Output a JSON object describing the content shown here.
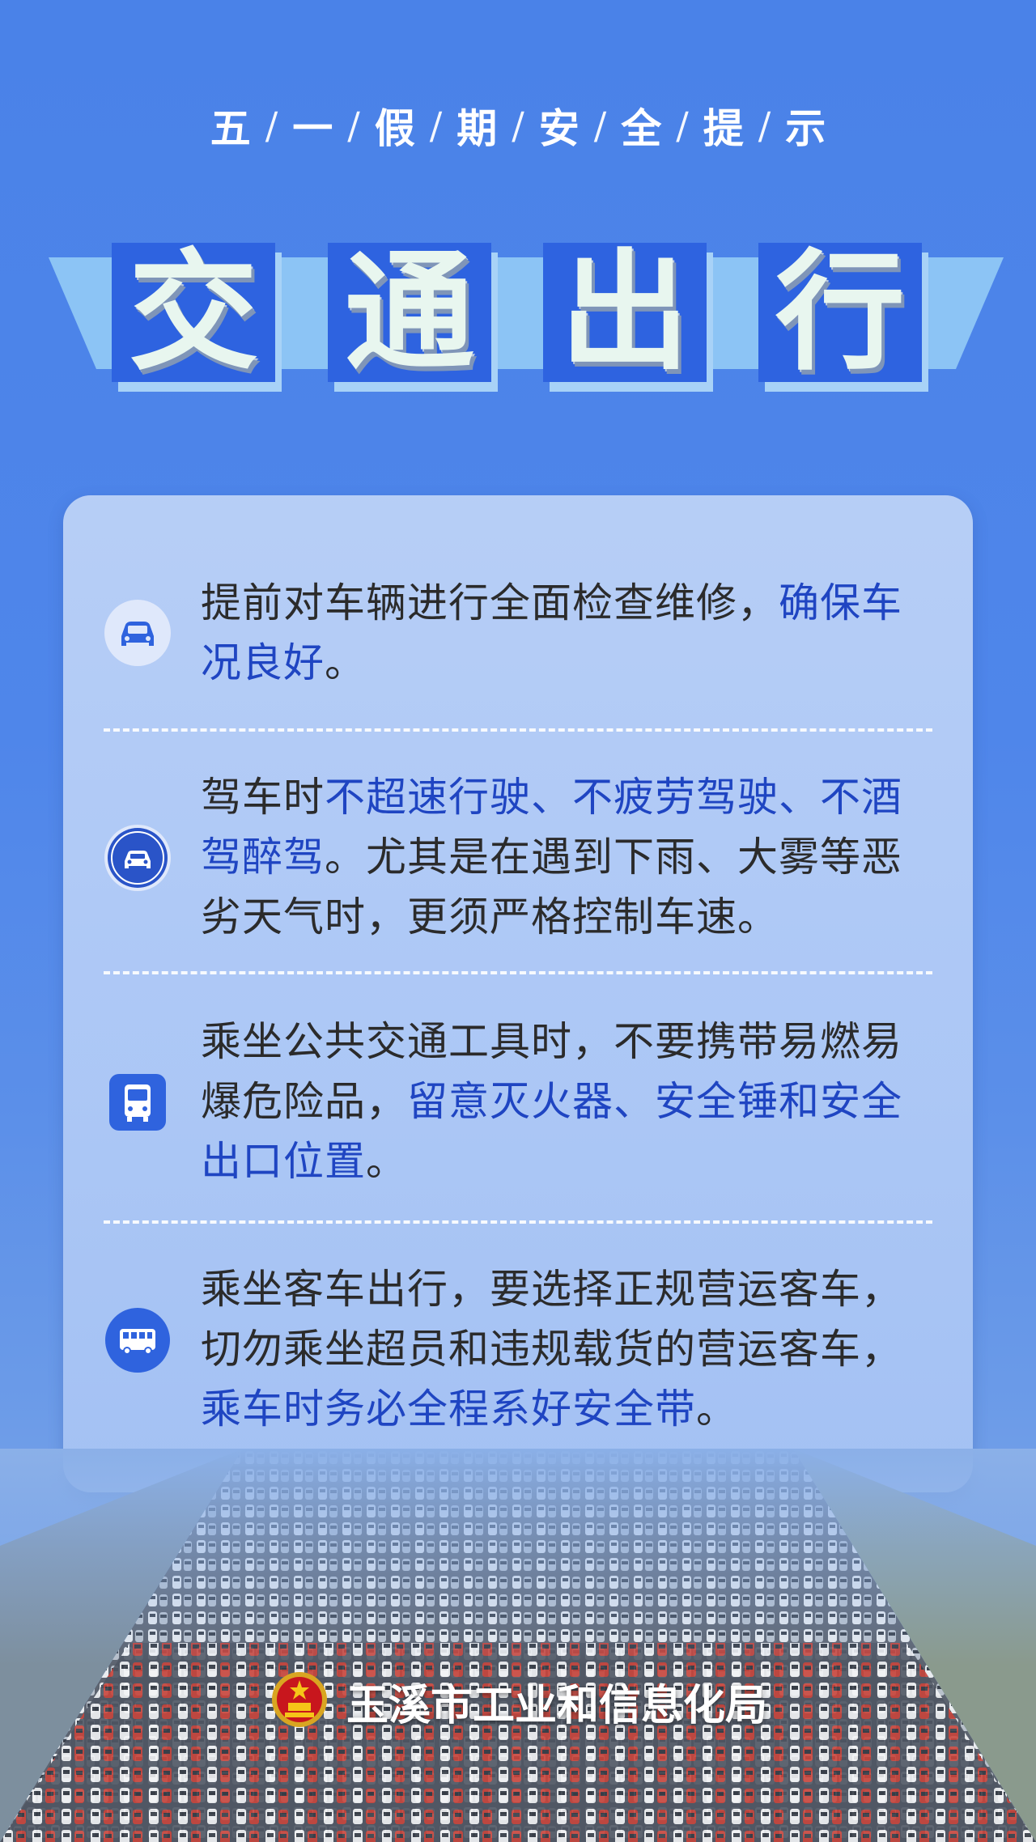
{
  "header": {
    "subtitle_chars": [
      "五",
      "一",
      "假",
      "期",
      "安",
      "全",
      "提",
      "示"
    ],
    "separator": "/",
    "title_chars": [
      "交",
      "通",
      "出",
      "行"
    ]
  },
  "tips": [
    {
      "icon": "car-front-icon",
      "segments": [
        {
          "text": "提前对车辆进行全面检查维修，",
          "highlight": false
        },
        {
          "text": "确保车况良好",
          "highlight": true
        },
        {
          "text": "。",
          "highlight": false
        }
      ]
    },
    {
      "icon": "car-badge-icon",
      "segments": [
        {
          "text": "驾车时",
          "highlight": false
        },
        {
          "text": "不超速行驶、不疲劳驾驶、不酒驾醉驾",
          "highlight": true
        },
        {
          "text": "。尤其是在遇到下雨、大雾等恶劣天气时，更须严格控制车速。",
          "highlight": false
        }
      ]
    },
    {
      "icon": "bus-icon",
      "segments": [
        {
          "text": "乘坐公共交通工具时，不要携带易燃易爆危险品，",
          "highlight": false
        },
        {
          "text": "留意灭火器、安全锤和安全出口位置",
          "highlight": true
        },
        {
          "text": "。",
          "highlight": false
        }
      ]
    },
    {
      "icon": "coach-icon",
      "segments": [
        {
          "text": "乘坐客车出行，要选择正规营运客车，切勿乘坐超员和违规载货的营运客车，",
          "highlight": false
        },
        {
          "text": "乘车时务必全程系好安全带",
          "highlight": true
        },
        {
          "text": "。",
          "highlight": false
        }
      ]
    }
  ],
  "footer": {
    "emblem": "national-emblem-icon",
    "organization": "玉溪市工业和信息化局"
  },
  "colors": {
    "background": "#4a82e8",
    "title_block": "#2e63e0",
    "highlight_text": "#1f45c2",
    "body_text": "#2b2b2b"
  }
}
